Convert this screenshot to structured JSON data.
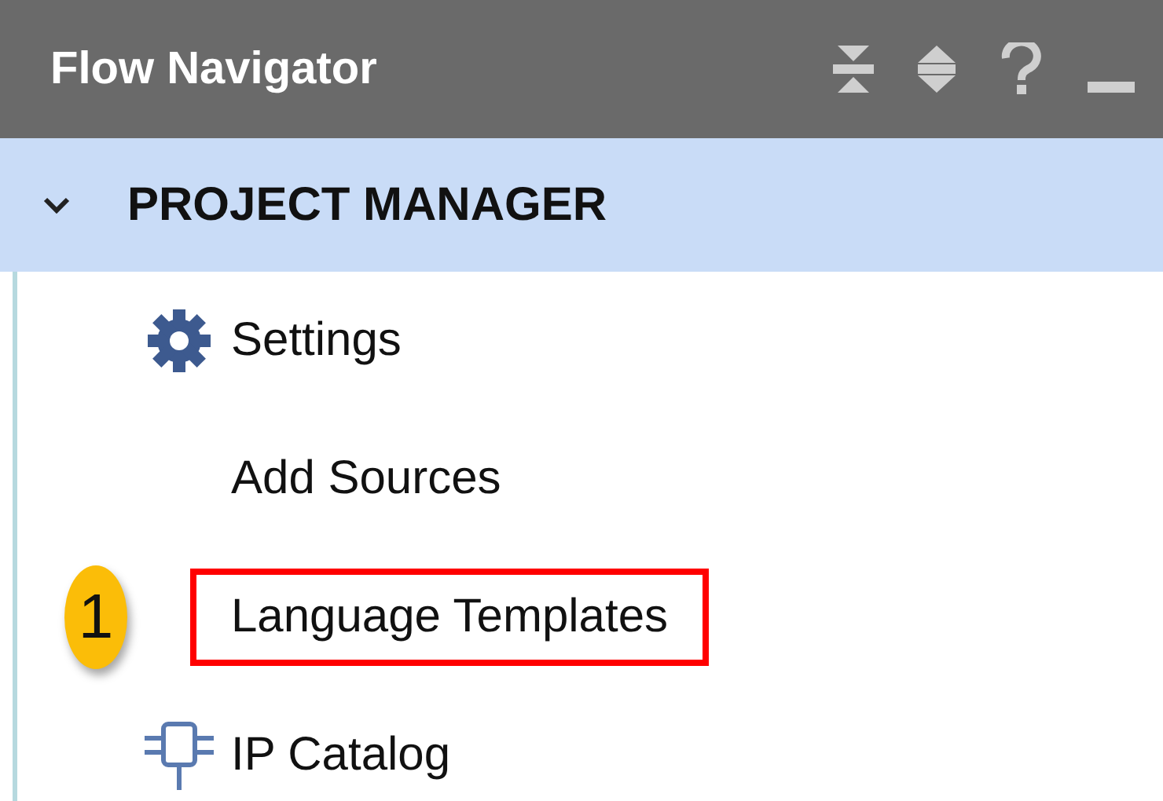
{
  "panel": {
    "title": "Flow Navigator",
    "tools": [
      {
        "kind": "collapse"
      },
      {
        "kind": "expand"
      },
      {
        "kind": "help"
      },
      {
        "kind": "minimize"
      }
    ]
  },
  "section": {
    "label": "PROJECT MANAGER",
    "expanded": true,
    "items": [
      {
        "label": "Settings",
        "kind": "gear",
        "highlighted": false
      },
      {
        "label": "Add Sources",
        "kind": "none",
        "highlighted": false
      },
      {
        "label": "Language Templates",
        "kind": "none",
        "highlighted": true,
        "callout": "1"
      },
      {
        "label": "IP Catalog",
        "kind": "ip",
        "highlighted": false
      }
    ]
  }
}
